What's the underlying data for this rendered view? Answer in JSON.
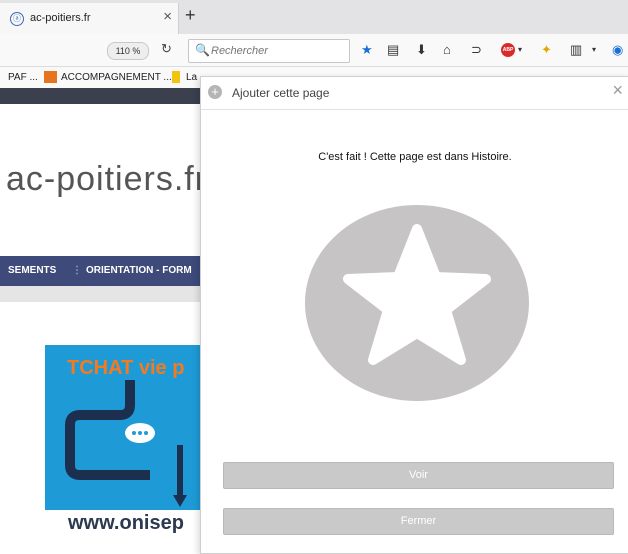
{
  "tab": {
    "title": "ac-poitiers.fr",
    "close": "×",
    "new_tab": "+"
  },
  "navbar": {
    "zoom": "110 %",
    "search_placeholder": "Rechercher"
  },
  "bookmarks": [
    {
      "label": "PAF ..."
    },
    {
      "label": "ACCOMPAGNEMENT ..."
    },
    {
      "label": "La"
    }
  ],
  "page": {
    "title": "ac-poitiers.fr",
    "nav_items": [
      "SEMENTS",
      "ORIENTATION - FORM"
    ],
    "banner_text": "TCHAT vie p",
    "banner_url": "www.onisep"
  },
  "panel": {
    "title": "Ajouter cette page",
    "close": "×",
    "message": "C'est fait ! Cette page est dans Histoire.",
    "view_button": "Voir",
    "close_button": "Fermer"
  },
  "colors": {
    "nav_bar": "#3d4a7a",
    "banner": "#1e9bd7",
    "button": "#c9c9c9",
    "star_circle": "#c6c4c4"
  }
}
